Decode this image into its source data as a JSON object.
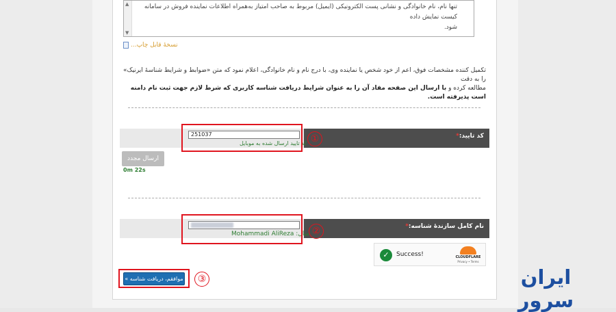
{
  "agreement": {
    "text_line1": "تنها نام، نام خانوادگی و نشانی پست الکترونیکی (ایمیل) مربوط به صاحب امتیاز به‌همراه اطلاعات نماینده فروش در سامانه کیست نمایش داده",
    "text_line2": "شود."
  },
  "print_link": "نسخهٔ قابل چاپ...",
  "terms": {
    "line1": "تکمیل کننده مشخصات فوق، اعم از خود شخص یا نماینده وی، با درج نام و نام خانوادگی، اعلام نمود که متن «ضوابط و شرایط شناسهٔ ایرنیک» را به دقت",
    "line2_plain": "مطالعه کرده و ",
    "line2_bold": "با ارسال این صفحه مفاد آن را به عنوان شرایط دریافت شناسه کاربری که شرط لازم جهت ثبت نام دامنه است پذیرفته است."
  },
  "verification": {
    "label": "کد تایید:",
    "required_mark": "*",
    "value": "251037",
    "hint": "کد تایید ارسال شده به موبایل",
    "resend_label": "ارسال مجدد",
    "timer": "0m 22s",
    "callout": "①"
  },
  "fullname": {
    "label": "نام کامل سازندهٔ شناسه:",
    "required_mark": "*",
    "value": "",
    "example_prefix": "مثال:",
    "example_value": "Mohammadi AliReza",
    "callout": "②"
  },
  "captcha": {
    "status": "Success!",
    "provider": "CLOUDFLARE",
    "links": "Privacy • Terms"
  },
  "submit": {
    "label": "موافقم، دریافت شناسه »",
    "callout": "③"
  },
  "brand": {
    "text": "ایران سرور",
    "color": "#1d4fa0"
  },
  "colors": {
    "highlight": "#e0141e",
    "label_bg": "#4d4d4d",
    "button": "#1f6fb2",
    "hint": "#2e7d32"
  }
}
